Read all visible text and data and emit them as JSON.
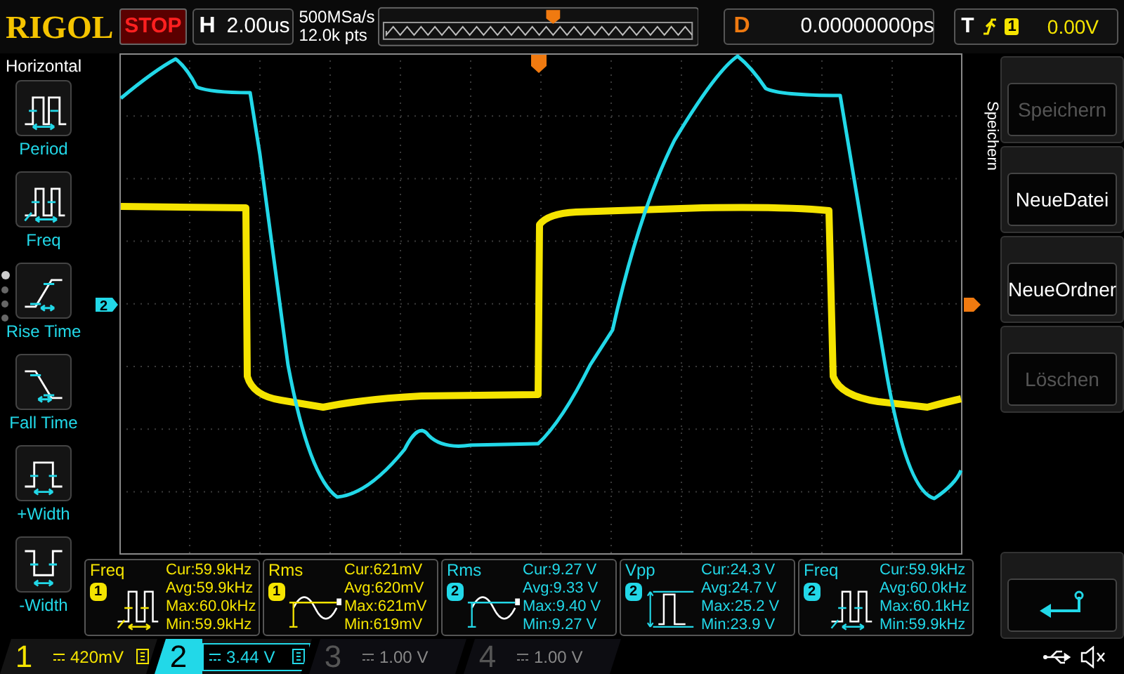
{
  "top_bar": {
    "logo": "RIGOL",
    "run_state": "STOP",
    "timebase": {
      "label": "H",
      "value": "2.00us"
    },
    "sample_rate": "500MSa/s",
    "memory_depth": "12.0k pts",
    "delay": {
      "label": "D",
      "value": "0.00000000ps"
    },
    "trigger": {
      "label": "T",
      "source": "1",
      "level": "0.00V"
    }
  },
  "left_menu": {
    "title": "Horizontal",
    "items": [
      {
        "label": "Period",
        "kind": "period"
      },
      {
        "label": "Freq",
        "kind": "freq"
      },
      {
        "label": "Rise Time",
        "kind": "rise"
      },
      {
        "label": "Fall Time",
        "kind": "fall"
      },
      {
        "label": "+Width",
        "kind": "pwidth"
      },
      {
        "label": "-Width",
        "kind": "nwidth"
      }
    ],
    "page_dots": [
      {
        "selected": true
      },
      {
        "selected": false
      },
      {
        "selected": false
      },
      {
        "selected": false
      }
    ]
  },
  "scope": {
    "channel_marker": "2"
  },
  "measurements": [
    {
      "label": "Freq",
      "channel": "1",
      "kind": "freq",
      "lines": [
        "Cur:59.9kHz",
        "Avg:59.9kHz",
        "Max:60.0kHz",
        "Min:59.9kHz"
      ]
    },
    {
      "label": "Rms",
      "channel": "1",
      "kind": "rms",
      "lines": [
        "Cur:621mV",
        "Avg:620mV",
        "Max:621mV",
        "Min:619mV"
      ]
    },
    {
      "label": "Rms",
      "channel": "2",
      "kind": "rms",
      "lines": [
        "Cur:9.27 V",
        "Avg:9.33 V",
        "Max:9.40 V",
        "Min:9.27 V"
      ]
    },
    {
      "label": "Vpp",
      "channel": "2",
      "kind": "vpp",
      "lines": [
        "Cur:24.3 V",
        "Avg:24.7 V",
        "Max:25.2 V",
        "Min:23.9 V"
      ]
    },
    {
      "label": "Freq",
      "channel": "2",
      "kind": "freq",
      "lines": [
        "Cur:59.9kHz",
        "Avg:60.0kHz",
        "Max:60.1kHz",
        "Min:59.9kHz"
      ]
    }
  ],
  "right_menu": {
    "title": "Speichern",
    "buttons": [
      {
        "kind": "text",
        "label": "Speichern",
        "disabled": true
      },
      {
        "kind": "text",
        "label": "NeueDatei",
        "disabled": false
      },
      {
        "kind": "text",
        "label": "NeueOrdner",
        "disabled": false
      },
      {
        "kind": "text",
        "label": "Löschen",
        "disabled": true
      },
      {
        "kind": "back",
        "disabled": false
      }
    ]
  },
  "channels": [
    {
      "number": "1",
      "scale": "420mV",
      "enabled": true,
      "selected": false
    },
    {
      "number": "2",
      "scale": "3.44 V",
      "enabled": true,
      "selected": true
    },
    {
      "number": "3",
      "scale": "1.00 V",
      "enabled": false,
      "selected": false
    },
    {
      "number": "4",
      "scale": "1.00 V",
      "enabled": false,
      "selected": false
    }
  ]
}
